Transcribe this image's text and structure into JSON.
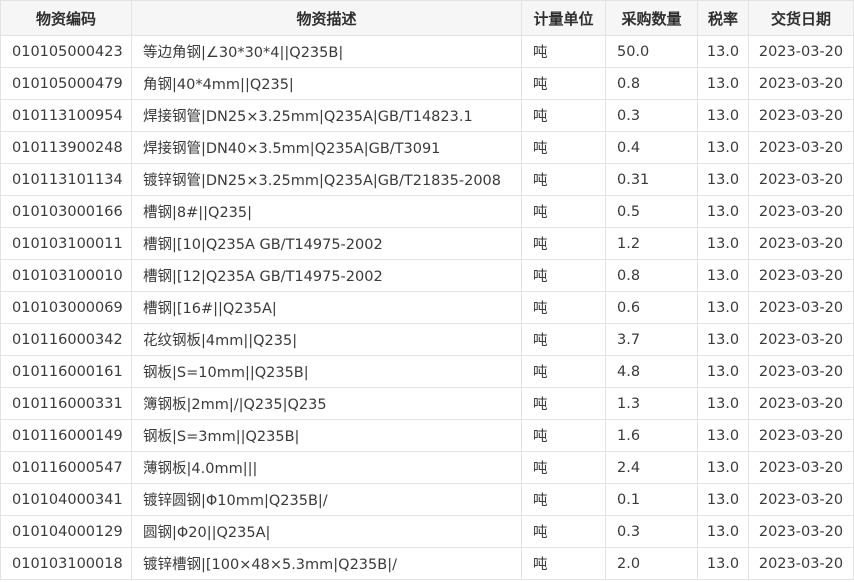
{
  "table": {
    "headers": [
      "物资编码",
      "物资描述",
      "计量单位",
      "采购数量",
      "税率",
      "交货日期"
    ],
    "rows": [
      [
        "010105000423",
        "等边角钢|∠30*30*4||Q235B|",
        "吨",
        "50.0",
        "13.0",
        "2023-03-20"
      ],
      [
        "010105000479",
        "角钢|40*4mm||Q235|",
        "吨",
        "0.8",
        "13.0",
        "2023-03-20"
      ],
      [
        "010113100954",
        "焊接钢管|DN25×3.25mm|Q235A|GB/T14823.1",
        "吨",
        "0.3",
        "13.0",
        "2023-03-20"
      ],
      [
        "010113900248",
        "焊接钢管|DN40×3.5mm|Q235A|GB/T3091",
        "吨",
        "0.4",
        "13.0",
        "2023-03-20"
      ],
      [
        "010113101134",
        "镀锌钢管|DN25×3.25mm|Q235A|GB/T21835-2008",
        "吨",
        "0.31",
        "13.0",
        "2023-03-20"
      ],
      [
        "010103000166",
        "槽钢|8#||Q235|",
        "吨",
        "0.5",
        "13.0",
        "2023-03-20"
      ],
      [
        "010103100011",
        "槽钢|[10|Q235A GB/T14975-2002",
        "吨",
        "1.2",
        "13.0",
        "2023-03-20"
      ],
      [
        "010103100010",
        "槽钢|[12|Q235A GB/T14975-2002",
        "吨",
        "0.8",
        "13.0",
        "2023-03-20"
      ],
      [
        "010103000069",
        "槽钢|[16#||Q235A|",
        "吨",
        "0.6",
        "13.0",
        "2023-03-20"
      ],
      [
        "010116000342",
        "花纹钢板|4mm||Q235|",
        "吨",
        "3.7",
        "13.0",
        "2023-03-20"
      ],
      [
        "010116000161",
        "钢板|S=10mm||Q235B|",
        "吨",
        "4.8",
        "13.0",
        "2023-03-20"
      ],
      [
        "010116000331",
        "簿钢板|2mm|/|Q235|Q235",
        "吨",
        "1.3",
        "13.0",
        "2023-03-20"
      ],
      [
        "010116000149",
        "钢板|S=3mm||Q235B|",
        "吨",
        "1.6",
        "13.0",
        "2023-03-20"
      ],
      [
        "010116000547",
        "薄钢板|4.0mm|||",
        "吨",
        "2.4",
        "13.0",
        "2023-03-20"
      ],
      [
        "010104000341",
        "镀锌圆钢|Φ10mm|Q235B|/",
        "吨",
        "0.1",
        "13.0",
        "2023-03-20"
      ],
      [
        "010104000129",
        "圆钢|Φ20||Q235A|",
        "吨",
        "0.3",
        "13.0",
        "2023-03-20"
      ],
      [
        "010103100018",
        "镀锌槽钢|[100×48×5.3mm|Q235B|/",
        "吨",
        "2.0",
        "13.0",
        "2023-03-20"
      ]
    ]
  }
}
